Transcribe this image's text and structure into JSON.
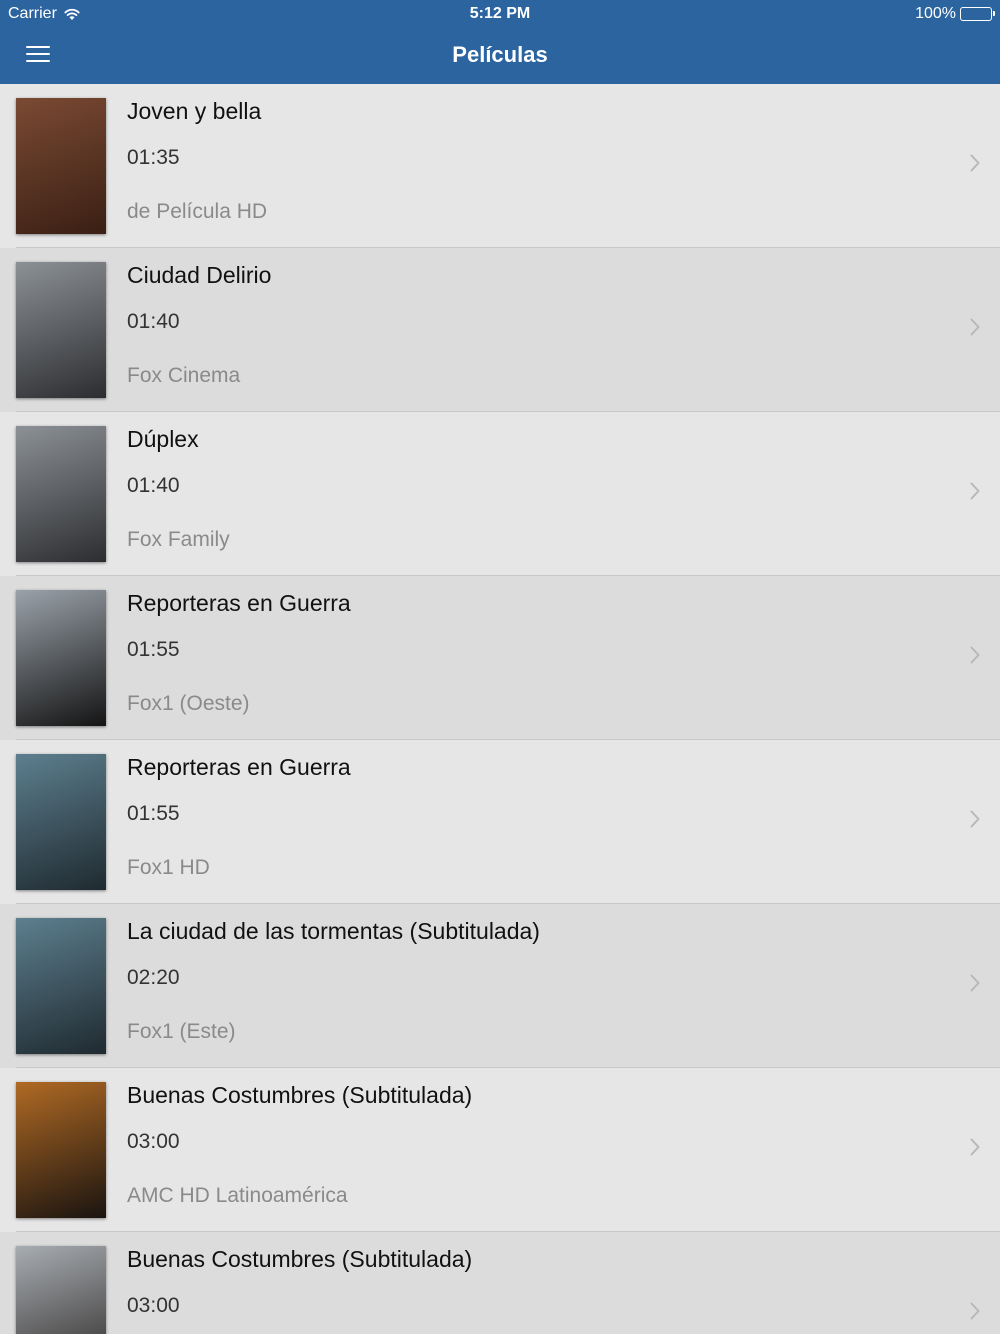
{
  "status_bar": {
    "carrier": "Carrier",
    "time": "5:12 PM",
    "battery": "100%"
  },
  "nav": {
    "title": "Películas"
  },
  "colors": {
    "header_bg": "#2c64a0",
    "row_bg": "#e6e6e6",
    "row_alt_bg": "#dcdcdc",
    "title_text": "#111111",
    "channel_text": "#8a8a8a"
  },
  "movies": [
    {
      "title": "Joven y bella",
      "time": "01:35",
      "channel": "de Película HD",
      "thumb": [
        "#7a4a33",
        "#3a1f14"
      ]
    },
    {
      "title": "Ciudad Delirio",
      "time": "01:40",
      "channel": "Fox Cinema",
      "thumb": [
        "#8c9196",
        "#2c2d30"
      ]
    },
    {
      "title": "Dúplex",
      "time": "01:40",
      "channel": "Fox Family",
      "thumb": [
        "#8c9196",
        "#2c2d30"
      ]
    },
    {
      "title": "Reporteras en Guerra",
      "time": "01:55",
      "channel": "Fox1 (Oeste)",
      "thumb": [
        "#9aa2aa",
        "#141414"
      ]
    },
    {
      "title": "Reporteras en Guerra",
      "time": "01:55",
      "channel": "Fox1 HD",
      "thumb": [
        "#5d7f8f",
        "#1f2a30"
      ]
    },
    {
      "title": "La ciudad de las tormentas (Subtitulada)",
      "time": "02:20",
      "channel": "Fox1 (Este)",
      "thumb": [
        "#5d7f8f",
        "#1f2a30"
      ]
    },
    {
      "title": "Buenas Costumbres (Subtitulada)",
      "time": "03:00",
      "channel": "AMC HD Latinoamérica",
      "thumb": [
        "#b06a24",
        "#1a1410"
      ]
    },
    {
      "title": "Buenas Costumbres (Subtitulada)",
      "time": "03:00",
      "channel": "",
      "thumb": [
        "#a8adb2",
        "#2a2624"
      ]
    }
  ]
}
